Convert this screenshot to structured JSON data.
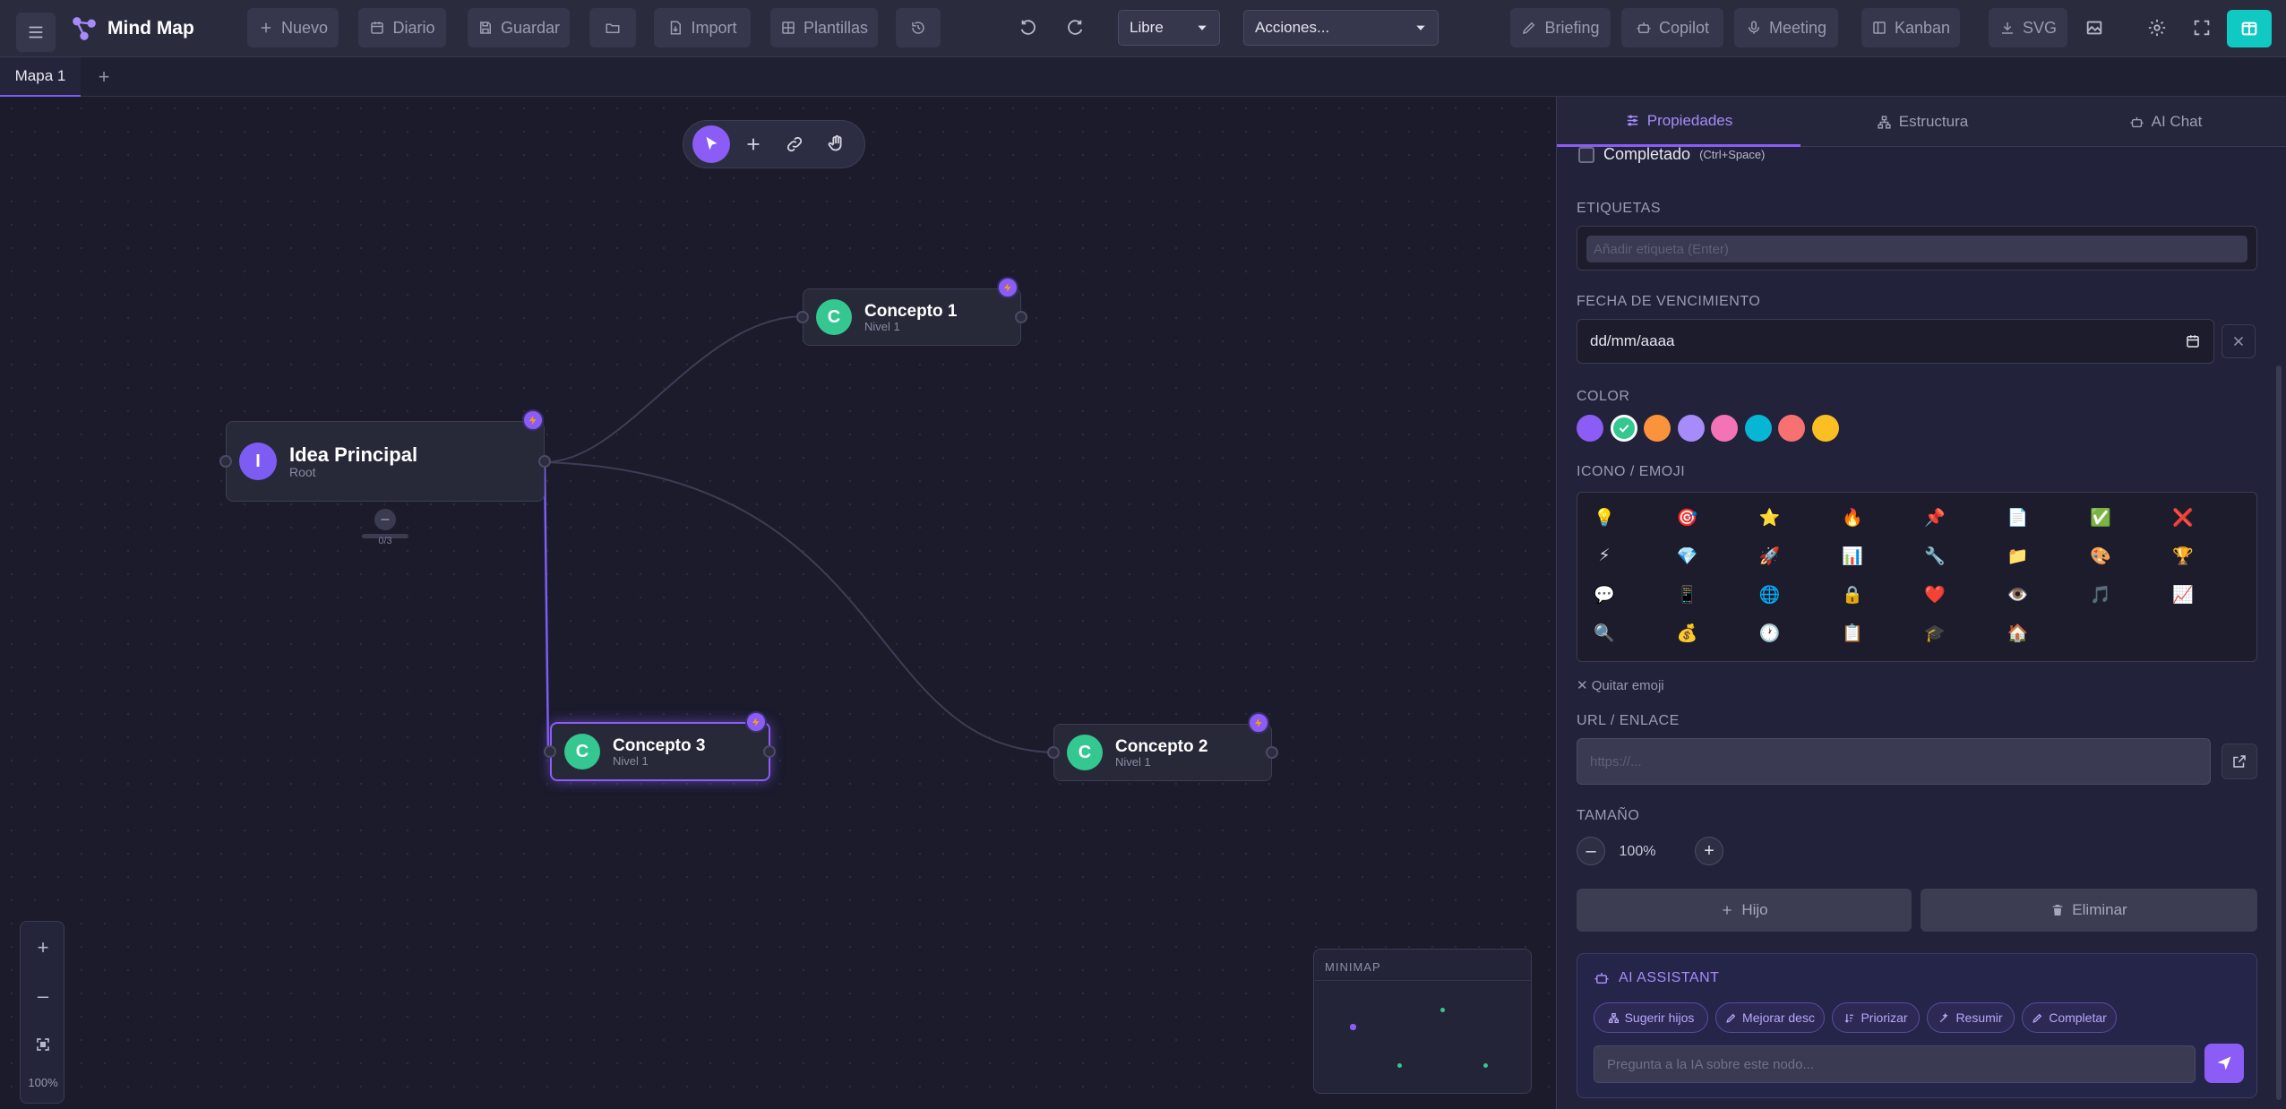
{
  "app": {
    "title": "Mind Map"
  },
  "toolbar": {
    "nuevo": "Nuevo",
    "diario": "Diario",
    "guardar": "Guardar",
    "import": "Import",
    "plantillas": "Plantillas",
    "layout_select": "Libre",
    "actions_select": "Acciones...",
    "briefing": "Briefing",
    "copilot": "Copilot",
    "meeting": "Meeting",
    "kanban": "Kanban",
    "svg": "SVG"
  },
  "tabs": [
    {
      "label": "Mapa 1"
    }
  ],
  "canvas": {
    "nodes": [
      {
        "initial": "I",
        "title": "Idea Principal",
        "subtitle": "Root",
        "avatar_color": "#7c5cf2"
      },
      {
        "initial": "C",
        "title": "Concepto 1",
        "subtitle": "Nivel 1",
        "avatar_color": "#34c78f"
      },
      {
        "initial": "C",
        "title": "Concepto 3",
        "subtitle": "Nivel 1",
        "avatar_color": "#34c78f"
      },
      {
        "initial": "C",
        "title": "Concepto 2",
        "subtitle": "Nivel 1",
        "avatar_color": "#34c78f"
      }
    ],
    "collapse_symbol": "–",
    "progress": "0/3",
    "zoom": {
      "in": "+",
      "out": "–",
      "level": "100%"
    },
    "minimap_label": "MINIMAP"
  },
  "panel": {
    "tabs": {
      "propiedades": "Propiedades",
      "estructura": "Estructura",
      "ai_chat": "AI Chat"
    },
    "completado": {
      "label": "Completado",
      "hint": "(Ctrl+Space)"
    },
    "etiquetas": {
      "label": "ETIQUETAS",
      "placeholder": "Añadir etiqueta (Enter)"
    },
    "fecha": {
      "label": "FECHA DE VENCIMIENTO",
      "value": "dd/mm/aaaa"
    },
    "color": {
      "label": "COLOR",
      "swatches": [
        "#8b5cf6",
        "#34c78f",
        "#fb923c",
        "#a78bfa",
        "#f472b6",
        "#06b6d4",
        "#f87171",
        "#fbbf24"
      ],
      "selected_index": 1
    },
    "icono": {
      "label": "ICONO / EMOJI",
      "emojis": [
        "💡",
        "🎯",
        "⭐",
        "🔥",
        "📌",
        "📄",
        "✅",
        "❌",
        "⚡",
        "💎",
        "🚀",
        "📊",
        "🔧",
        "📁",
        "🎨",
        "🏆",
        "💬",
        "📱",
        "🌐",
        "🔒",
        "❤️",
        "👁️",
        "🎵",
        "📈",
        "🔍",
        "💰",
        "🕐",
        "📋",
        "🎓",
        "🏠"
      ],
      "remove": "Quitar emoji"
    },
    "url": {
      "label": "URL / ENLACE",
      "placeholder": "https://..."
    },
    "tamano": {
      "label": "TAMAÑO",
      "value": "100%",
      "minus": "–",
      "plus": "+"
    },
    "hijo": "Hijo",
    "eliminar": "Eliminar",
    "ai": {
      "title": "AI ASSISTANT",
      "chips": [
        "Sugerir hijos",
        "Mejorar desc",
        "Priorizar",
        "Resumir",
        "Completar"
      ],
      "input_placeholder": "Pregunta a la IA sobre este nodo..."
    }
  }
}
